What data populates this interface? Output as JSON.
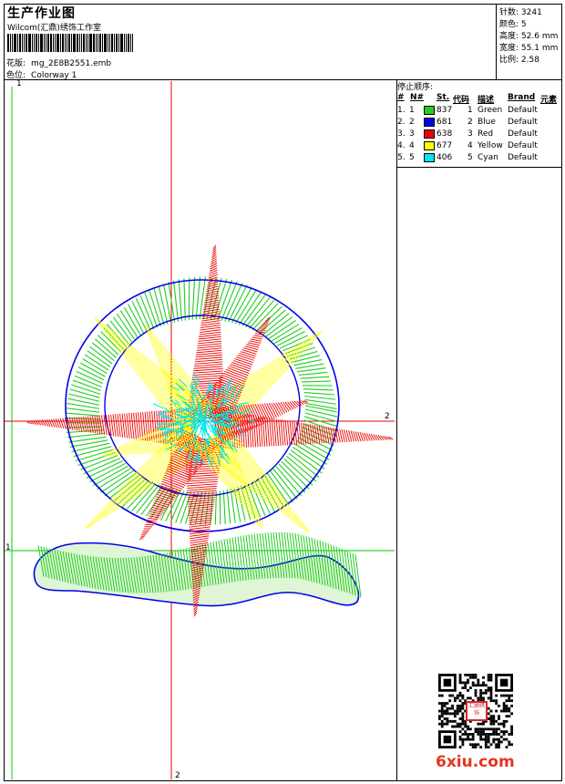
{
  "header": {
    "title": "生产作业图",
    "company": "Wilcom(汇鼎)绣饰工作室",
    "design_label": "花版:",
    "design_value": "mg_2E8B2551.emb",
    "colorway_label": "色位:",
    "colorway_value": "Colorway 1"
  },
  "stats": [
    {
      "label": "针数:",
      "value": "3241"
    },
    {
      "label": "颜色:",
      "value": "5"
    },
    {
      "label": "高度:",
      "value": "52.6 mm"
    },
    {
      "label": "宽度:",
      "value": "55.1 mm"
    },
    {
      "label": "比例:",
      "value": "2.58"
    }
  ],
  "stop_sequence": {
    "title": "停止顺序:",
    "columns": [
      "#",
      "N#",
      "St.",
      "代码",
      "描述",
      "Brand",
      "元素"
    ],
    "rows": [
      {
        "num": "1.",
        "n": "1",
        "color": "#22cc22",
        "st": "837",
        "code": "1",
        "desc": "Green",
        "brand": "Default"
      },
      {
        "num": "2.",
        "n": "2",
        "color": "#0000ee",
        "st": "681",
        "code": "2",
        "desc": "Blue",
        "brand": "Default"
      },
      {
        "num": "3.",
        "n": "3",
        "color": "#ee0000",
        "st": "638",
        "code": "3",
        "desc": "Red",
        "brand": "Default"
      },
      {
        "num": "4.",
        "n": "4",
        "color": "#ffff00",
        "st": "677",
        "code": "4",
        "desc": "Yellow",
        "brand": "Default"
      },
      {
        "num": "5.",
        "n": "5",
        "color": "#00e5ee",
        "st": "406",
        "code": "5",
        "desc": "Cyan",
        "brand": "Default"
      }
    ]
  },
  "axes": {
    "green_v": "1",
    "green_h": "1",
    "red_h": "2",
    "red_v": "2"
  },
  "watermark": "6xiu.com",
  "seal_text": "汇鼎绣饰"
}
